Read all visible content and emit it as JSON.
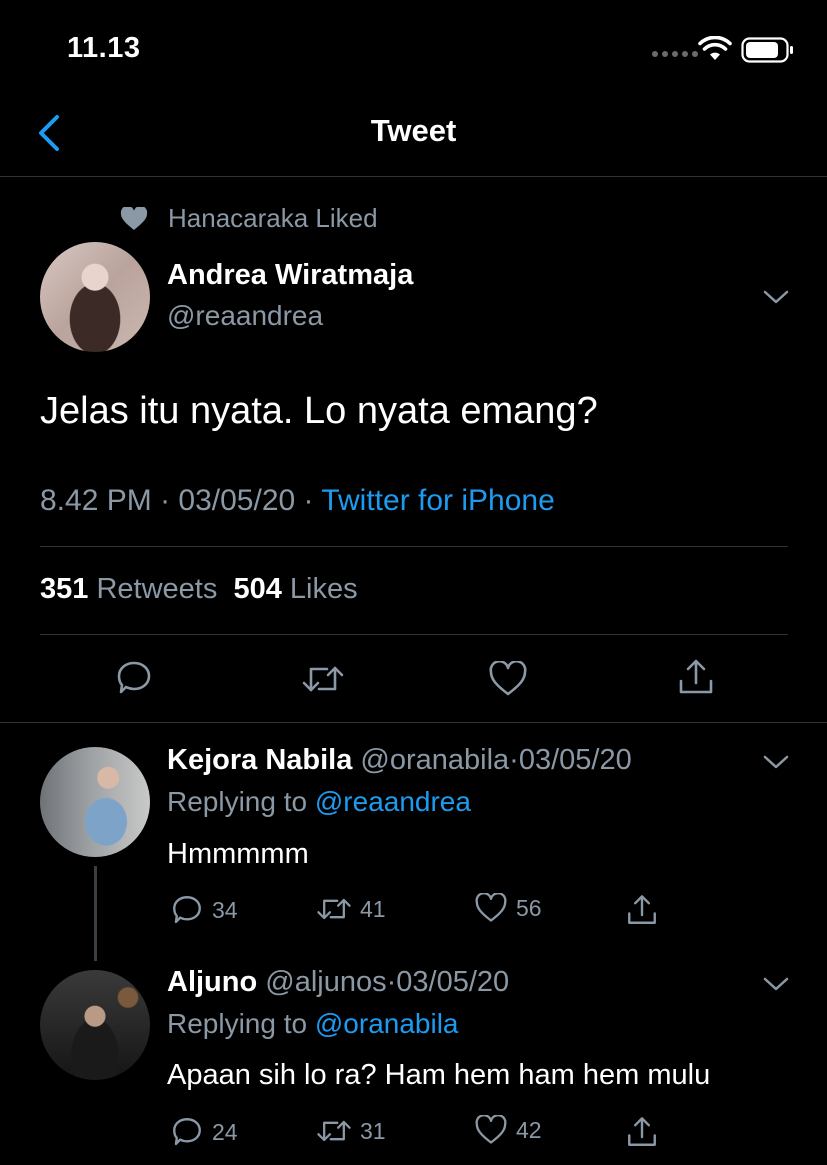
{
  "status_bar": {
    "time": "11.13"
  },
  "header": {
    "title": "Tweet"
  },
  "main_tweet": {
    "social_context": "Hanacaraka Liked",
    "author_name": "Andrea Wiratmaja",
    "author_handle": "@reaandrea",
    "text": "Jelas itu nyata. Lo nyata emang?",
    "time": "8.42 PM",
    "date": "03/05/20",
    "source": "Twitter for iPhone",
    "separator": "·",
    "retweets_count": "351",
    "retweets_label": "Retweets",
    "likes_count": "504",
    "likes_label": "Likes"
  },
  "replies": [
    {
      "name": "Kejora Nabila",
      "handle": "@oranabila",
      "date": "03/05/20",
      "replying_prefix": "Replying to",
      "replying_to": "@reaandrea",
      "text": "Hmmmmm",
      "replies": "34",
      "retweets": "41",
      "likes": "56"
    },
    {
      "name": "Aljuno",
      "handle": "@aljunos",
      "date": "03/05/20",
      "replying_prefix": "Replying to",
      "replying_to": "@oranabila",
      "text": "Apaan sih lo ra? Ham hem ham hem mulu",
      "replies": "24",
      "retweets": "31",
      "likes": "42"
    }
  ],
  "colors": {
    "accent": "#1d9bf0",
    "secondary_text": "#8b98a5",
    "background": "#000000"
  }
}
